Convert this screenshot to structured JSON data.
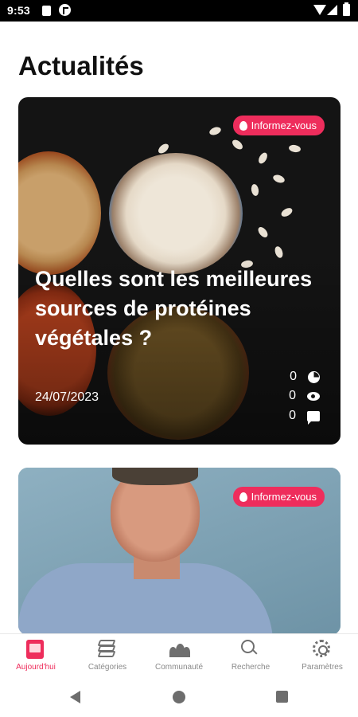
{
  "status_bar": {
    "time": "9:53"
  },
  "page": {
    "title": "Actualités"
  },
  "articles": [
    {
      "badge": "Informez-vous",
      "title": "Quelles sont les meilleures sources de protéines végétales ?",
      "date": "24/07/2023",
      "stats": {
        "reactions": "0",
        "views": "0",
        "comments": "0"
      }
    },
    {
      "badge": "Informez-vous"
    }
  ],
  "bottom_nav": {
    "items": [
      {
        "label": "Aujourd'hui",
        "icon": "today-icon",
        "active": true
      },
      {
        "label": "Catégories",
        "icon": "layers-icon",
        "active": false
      },
      {
        "label": "Communauté",
        "icon": "people-icon",
        "active": false
      },
      {
        "label": "Recherche",
        "icon": "search-icon",
        "active": false
      },
      {
        "label": "Paramètres",
        "icon": "gear-icon",
        "active": false
      }
    ]
  },
  "colors": {
    "accent": "#ee2d5c",
    "nav_inactive": "#8a8a8a"
  }
}
